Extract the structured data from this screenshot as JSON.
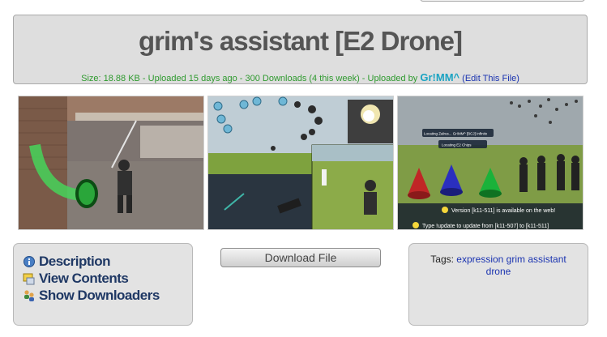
{
  "header": {
    "title": "grim's assistant [E2 Drone]",
    "meta_prefix": "Size: 18.88 KB - Uploaded 15 days ago - 300 Downloads (4 this week) - Uploaded by",
    "uploader": "Gr!MM^",
    "edit_link": "(Edit This File)"
  },
  "screenshots": {
    "shot3_tooltips": [
      "Locating Zalrus... Gr!MM^ [BCJ] Infinitx",
      "Locating E2 Chips"
    ],
    "shot3_notices": [
      "Version [k11-511] is available on the web!",
      "Type !update to update from [k11-507] to [k11-511]"
    ]
  },
  "links": [
    {
      "label": "Description",
      "icon": "info-icon"
    },
    {
      "label": "View Contents",
      "icon": "contents-icon"
    },
    {
      "label": "Show Downloaders",
      "icon": "users-icon"
    }
  ],
  "download": {
    "label": "Download File"
  },
  "tags": {
    "prefix": "Tags:",
    "values": [
      "expression",
      "grim",
      "assistant",
      "drone"
    ]
  },
  "colors": {
    "meta_green": "#2e9a2e",
    "link_blue": "#1a33b0",
    "uploader_cyan": "#1aa3c2",
    "panel_gray": "#e3e3e3"
  }
}
